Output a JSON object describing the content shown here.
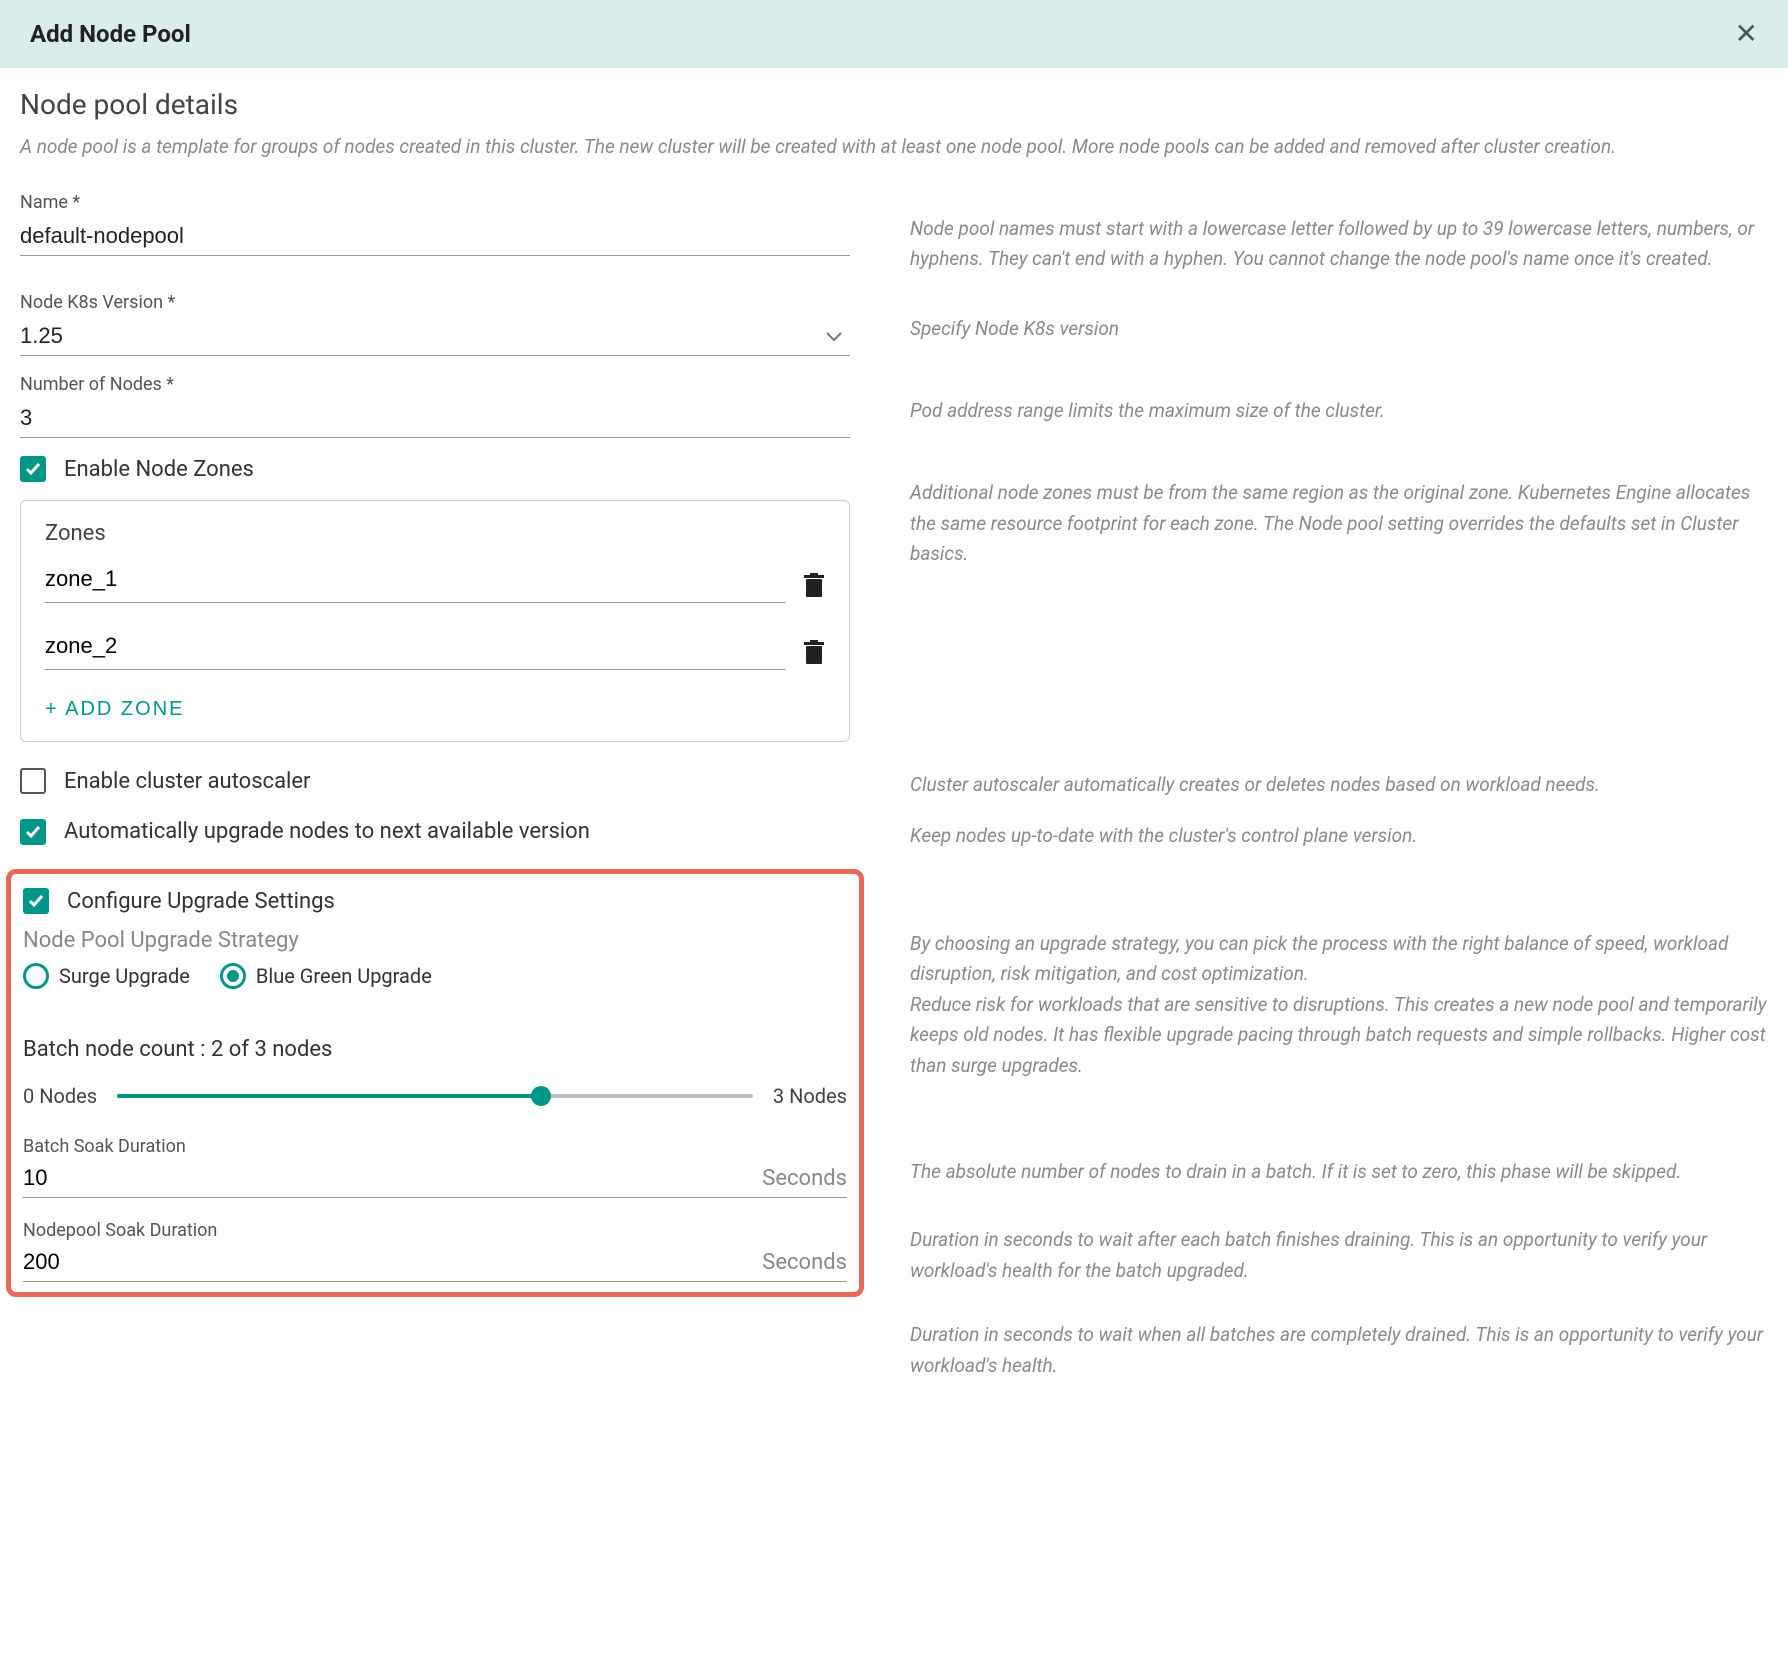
{
  "header": {
    "title": "Add Node Pool"
  },
  "section": {
    "title": "Node pool details",
    "description": "A node pool is a template for groups of nodes created in this cluster. The new cluster will be created with at least one node pool. More node pools can be added and removed after cluster creation."
  },
  "name": {
    "label": "Name *",
    "value": "default-nodepool",
    "help": "Node pool names must start with a lowercase letter followed by up to 39 lowercase letters, numbers, or hyphens. They can't end with a hyphen. You cannot change the node pool's name once it's created."
  },
  "k8s": {
    "label": "Node K8s Version *",
    "value": "1.25",
    "help": "Specify Node K8s version"
  },
  "num_nodes": {
    "label": "Number of Nodes *",
    "value": "3",
    "help": "Pod address range limits the maximum size of the cluster."
  },
  "zones": {
    "enable_label": "Enable Node Zones",
    "card_title": "Zones",
    "items": [
      "zone_1",
      "zone_2"
    ],
    "add_label": "+ ADD ZONE",
    "help": "Additional node zones must be from the same region as the original zone. Kubernetes Engine allocates the same resource footprint for each zone. The Node pool setting overrides the defaults set in Cluster basics."
  },
  "autoscaler": {
    "label": "Enable cluster autoscaler",
    "help": "Cluster autoscaler automatically creates or deletes nodes based on workload needs."
  },
  "auto_upgrade": {
    "label": "Automatically upgrade nodes to next available version",
    "help": "Keep nodes up-to-date with the cluster's control plane version."
  },
  "upgrade": {
    "configure_label": "Configure Upgrade Settings",
    "strategy_label": "Node Pool Upgrade Strategy",
    "options": {
      "surge": "Surge Upgrade",
      "blue_green": "Blue Green Upgrade"
    },
    "help1": "By choosing an upgrade strategy, you can pick the process with the right balance of speed, workload disruption, risk mitigation, and cost optimization.",
    "help2": "Reduce risk for workloads that are sensitive to disruptions. This creates a new node pool and temporarily keeps old nodes. It has flexible upgrade pacing through batch requests and simple rollbacks. Higher cost than surge upgrades."
  },
  "batch": {
    "title": "Batch node count : 2 of 3 nodes",
    "min_label": "0 Nodes",
    "max_label": "3 Nodes",
    "fill_percent": "66.6%",
    "help": "The absolute number of nodes to drain in a batch. If it is set to zero, this phase will be skipped."
  },
  "batch_soak": {
    "label": "Batch Soak Duration",
    "value": "10",
    "unit": "Seconds",
    "help": "Duration in seconds to wait after each batch finishes draining. This is an opportunity to verify your workload's health for the batch upgraded."
  },
  "pool_soak": {
    "label": "Nodepool Soak Duration",
    "value": "200",
    "unit": "Seconds",
    "help": "Duration in seconds to wait when all batches are completely drained. This is an opportunity to verify your workload's health."
  }
}
